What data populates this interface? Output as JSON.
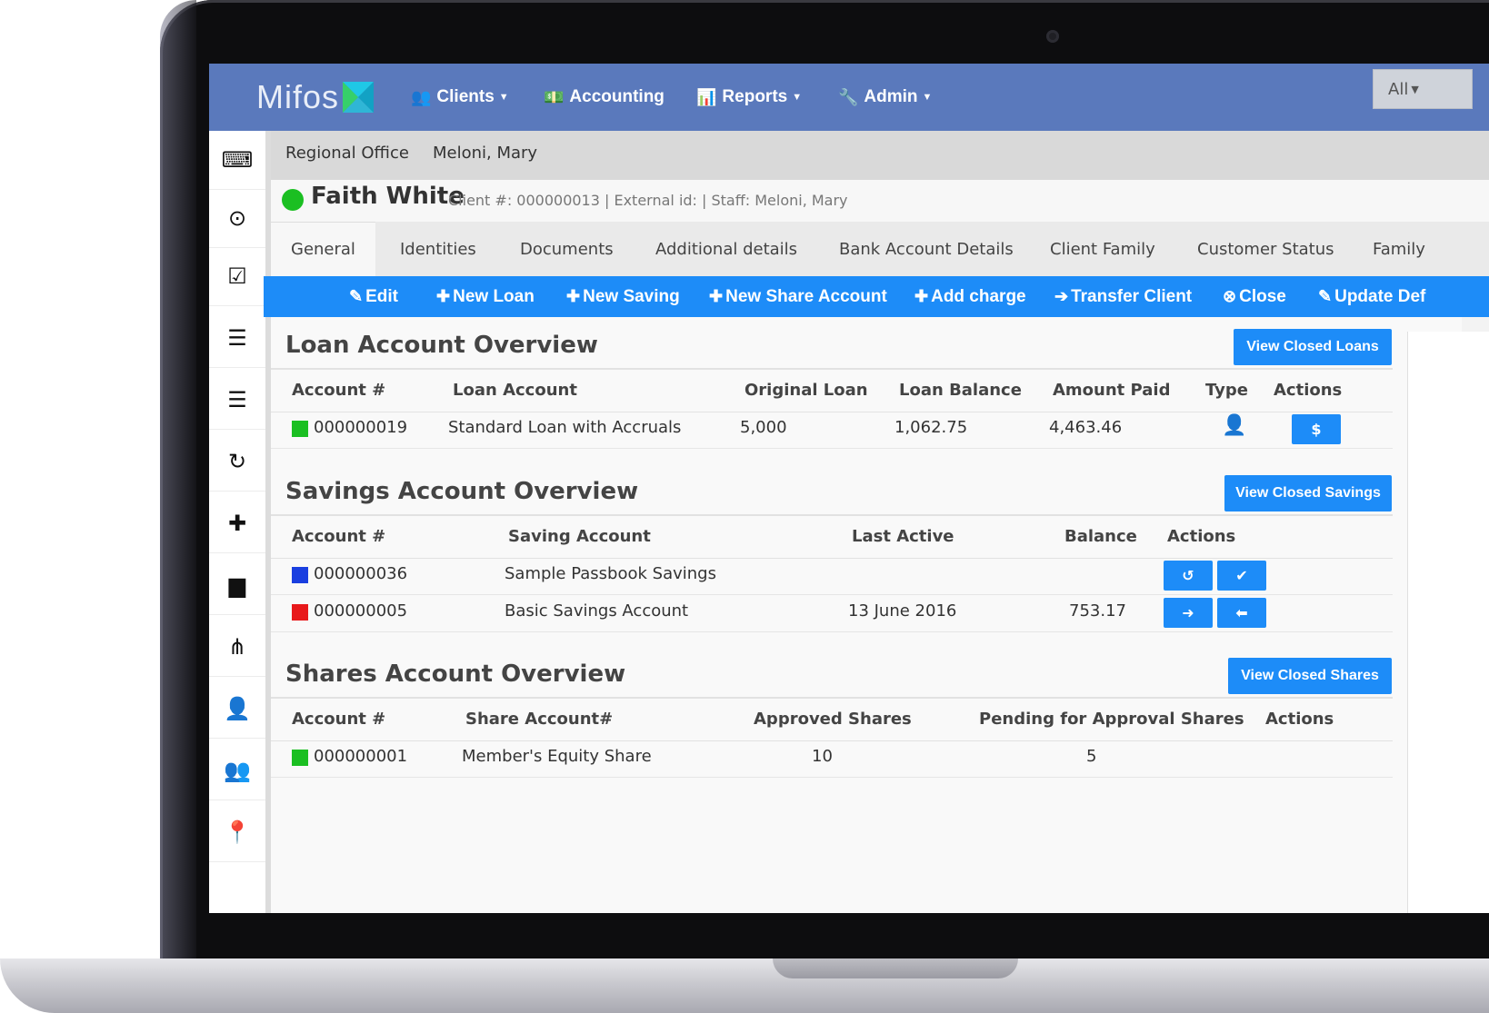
{
  "topnav": {
    "brand": "Mifos",
    "items": [
      {
        "icon": "users-icon",
        "glyph": "👥",
        "label": "Clients",
        "has_caret": true
      },
      {
        "icon": "money-icon",
        "glyph": "💵",
        "label": "Accounting",
        "has_caret": false
      },
      {
        "icon": "bar-chart-icon",
        "glyph": "📊",
        "label": "Reports",
        "has_caret": true
      },
      {
        "icon": "wrench-icon",
        "glyph": "🔧",
        "label": "Admin",
        "has_caret": true
      }
    ],
    "scope_select": "All"
  },
  "sidebar": {
    "icons": [
      {
        "name": "keyboard-icon",
        "glyph": "⌨"
      },
      {
        "name": "compass-icon",
        "glyph": "⊙"
      },
      {
        "name": "checkbox-icon",
        "glyph": "☑"
      },
      {
        "name": "server-icon",
        "glyph": "☰"
      },
      {
        "name": "server-icon-2",
        "glyph": "☰"
      },
      {
        "name": "refresh-icon",
        "glyph": "↻"
      },
      {
        "name": "plus-icon",
        "glyph": "✚"
      },
      {
        "name": "folder-icon",
        "glyph": "▆"
      },
      {
        "name": "sitemap-icon",
        "glyph": "⋔"
      },
      {
        "name": "user-icon",
        "glyph": "👤"
      },
      {
        "name": "group-icon",
        "glyph": "👥"
      },
      {
        "name": "map-marker-icon",
        "glyph": "📍"
      }
    ]
  },
  "breadcrumb": {
    "office": "Regional Office",
    "staff": "Meloni, Mary"
  },
  "client": {
    "name": "Faith White",
    "meta": "Client #: 000000013 | External id:  | Staff: Meloni, Mary",
    "status_color": "#1bbf22"
  },
  "tabs": [
    "General",
    "Identities",
    "Documents",
    "Additional details",
    "Bank Account Details",
    "Client Family",
    "Customer Status",
    "Family"
  ],
  "actions": [
    {
      "glyph": "✎",
      "label": "Edit"
    },
    {
      "glyph": "✚",
      "label": "New Loan"
    },
    {
      "glyph": "✚",
      "label": "New Saving"
    },
    {
      "glyph": "✚",
      "label": "New Share Account"
    },
    {
      "glyph": "✚",
      "label": "Add charge"
    },
    {
      "glyph": "➔",
      "label": "Transfer Client"
    },
    {
      "glyph": "⊗",
      "label": "Close"
    },
    {
      "glyph": "✎",
      "label": "Update Def"
    }
  ],
  "loans": {
    "title": "Loan Account Overview",
    "view_closed": "View Closed Loans",
    "headers": [
      "Account #",
      "Loan Account",
      "Original Loan",
      "Loan Balance",
      "Amount Paid",
      "Type",
      "Actions"
    ],
    "rows": [
      {
        "status_color": "#1bbf22",
        "account": "000000019",
        "product": "Standard Loan with Accruals",
        "original": "5,000",
        "balance": "1,062.75",
        "paid": "4,463.46",
        "type_icon": "user-icon",
        "action": "$"
      }
    ]
  },
  "savings": {
    "title": "Savings Account Overview",
    "view_closed": "View Closed Savings",
    "headers": [
      "Account #",
      "Saving Account",
      "Last Active",
      "Balance",
      "Actions"
    ],
    "rows": [
      {
        "status_color": "#1a3fe0",
        "account": "000000036",
        "product": "Sample Passbook Savings",
        "last_active": "",
        "balance": "",
        "actions": [
          "↺",
          "✔"
        ]
      },
      {
        "status_color": "#e8191b",
        "account": "000000005",
        "product": "Basic Savings Account",
        "last_active": "13 June 2016",
        "balance": "753.17",
        "actions": [
          "➜",
          "⬅"
        ]
      }
    ]
  },
  "shares": {
    "title": "Shares Account Overview",
    "view_closed": "View Closed Shares",
    "headers": [
      "Account #",
      "Share Account#",
      "Approved Shares",
      "Pending for Approval Shares",
      "Actions"
    ],
    "rows": [
      {
        "status_color": "#1bbf22",
        "account": "000000001",
        "product": "Member's Equity Share",
        "approved": "10",
        "pending": "5"
      }
    ]
  }
}
